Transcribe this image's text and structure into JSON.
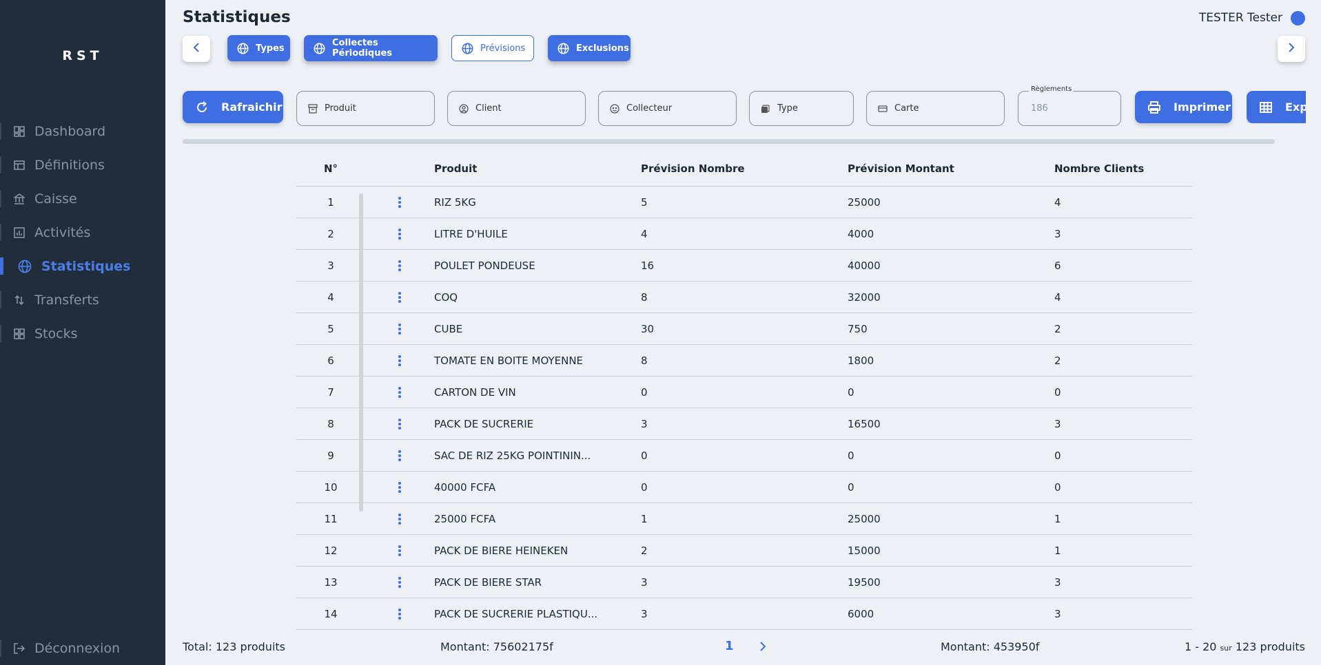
{
  "app": {
    "brand": "RST"
  },
  "sidebar": {
    "items": [
      {
        "label": "Dashboard",
        "icon": "dashboard-icon"
      },
      {
        "label": "Définitions",
        "icon": "table-icon"
      },
      {
        "label": "Caisse",
        "icon": "bank-icon"
      },
      {
        "label": "Activités",
        "icon": "chart-icon"
      },
      {
        "label": "Statistiques",
        "icon": "globe-icon",
        "active": true
      },
      {
        "label": "Transferts",
        "icon": "transfer-icon"
      },
      {
        "label": "Stocks",
        "icon": "grid-icon"
      }
    ],
    "logout": "Déconnexion"
  },
  "header": {
    "title": "Statistiques",
    "user": "TESTER Tester"
  },
  "tabs": [
    {
      "label": "Types"
    },
    {
      "label": "Collectes Périodiques"
    },
    {
      "label": "Prévisions",
      "selected": true
    },
    {
      "label": "Exclusions"
    }
  ],
  "filters": {
    "refresh_label": "Rafraichir",
    "produit": "Produit",
    "client": "Client",
    "collecteur": "Collecteur",
    "type": "Type",
    "carte": "Carte",
    "reglements_label": "Règlements",
    "reglements_value": "186",
    "print_label": "Imprimer",
    "export_label": "Expo"
  },
  "table": {
    "headers": [
      "N°",
      "Produit",
      "Prévision Nombre",
      "Prévision Montant",
      "Nombre Clients"
    ],
    "rows": [
      [
        "1",
        "RIZ 5KG",
        "5",
        "25000",
        "4"
      ],
      [
        "2",
        "LITRE D'HUILE",
        "4",
        "4000",
        "3"
      ],
      [
        "3",
        "POULET PONDEUSE",
        "16",
        "40000",
        "6"
      ],
      [
        "4",
        "COQ",
        "8",
        "32000",
        "4"
      ],
      [
        "5",
        "CUBE",
        "30",
        "750",
        "2"
      ],
      [
        "6",
        "TOMATE EN BOITE MOYENNE",
        "8",
        "1800",
        "2"
      ],
      [
        "7",
        "CARTON DE VIN",
        "0",
        "0",
        "0"
      ],
      [
        "8",
        "PACK DE SUCRERIE",
        "3",
        "16500",
        "3"
      ],
      [
        "9",
        "SAC DE RIZ 25KG POINTININ...",
        "0",
        "0",
        "0"
      ],
      [
        "10",
        "40000 FCFA",
        "0",
        "0",
        "0"
      ],
      [
        "11",
        "25000 FCFA",
        "1",
        "25000",
        "1"
      ],
      [
        "12",
        "PACK DE BIERE HEINEKEN",
        "2",
        "15000",
        "1"
      ],
      [
        "13",
        "PACK DE BIERE STAR",
        "3",
        "19500",
        "3"
      ],
      [
        "14",
        "PACK DE SUCRERIE PLASTIQU...",
        "3",
        "6000",
        "3"
      ]
    ]
  },
  "footer": {
    "total": "Total: 123 produits",
    "montant_left": "Montant: 75602175f",
    "page": "1",
    "montant_right": "Montant: 453950f",
    "range": "1 - 20",
    "sur": "sur",
    "count": "123 produits"
  },
  "colors": {
    "primary": "#3e6ee2",
    "sidebar": "#222d3c",
    "background": "#edf1f6"
  }
}
